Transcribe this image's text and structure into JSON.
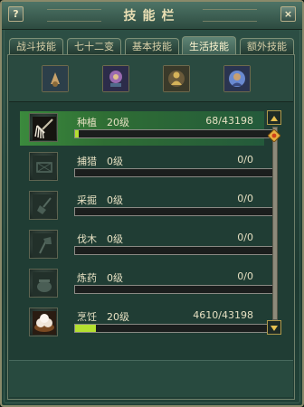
{
  "window": {
    "title": "技能栏",
    "help_label": "?",
    "close_label": "×"
  },
  "tabs": [
    {
      "label": "战斗技能",
      "active": false
    },
    {
      "label": "七十二变",
      "active": false
    },
    {
      "label": "基本技能",
      "active": false
    },
    {
      "label": "生活技能",
      "active": true
    },
    {
      "label": "额外技能",
      "active": false
    }
  ],
  "categories": [
    {
      "icon": "craft-category-icon",
      "color": "#c9a26a"
    },
    {
      "icon": "flower-category-icon",
      "color": "#9a6ab0"
    },
    {
      "icon": "figure-category-icon",
      "color": "#d6b35a"
    },
    {
      "icon": "orb-category-icon",
      "color": "#6a8ad0"
    }
  ],
  "skills": [
    {
      "name": "种植",
      "level": "20级",
      "exp": "68/43198",
      "progress": 0.0016,
      "icon": "rake-icon",
      "selected": true
    },
    {
      "name": "捕猎",
      "level": "0级",
      "exp": "0/0",
      "progress": 0,
      "icon": "trap-icon",
      "selected": false
    },
    {
      "name": "采掘",
      "level": "0级",
      "exp": "0/0",
      "progress": 0,
      "icon": "shovel-icon",
      "selected": false
    },
    {
      "name": "伐木",
      "level": "0级",
      "exp": "0/0",
      "progress": 0,
      "icon": "axe-icon",
      "selected": false
    },
    {
      "name": "炼药",
      "level": "0级",
      "exp": "0/0",
      "progress": 0,
      "icon": "cauldron-icon",
      "selected": false
    },
    {
      "name": "烹饪",
      "level": "20级",
      "exp": "4610/43198",
      "progress": 0.1067,
      "icon": "buns-icon",
      "selected": false
    }
  ],
  "colors": {
    "selected_row": "#3b8a3d",
    "progress_fill": "#b4e030"
  }
}
